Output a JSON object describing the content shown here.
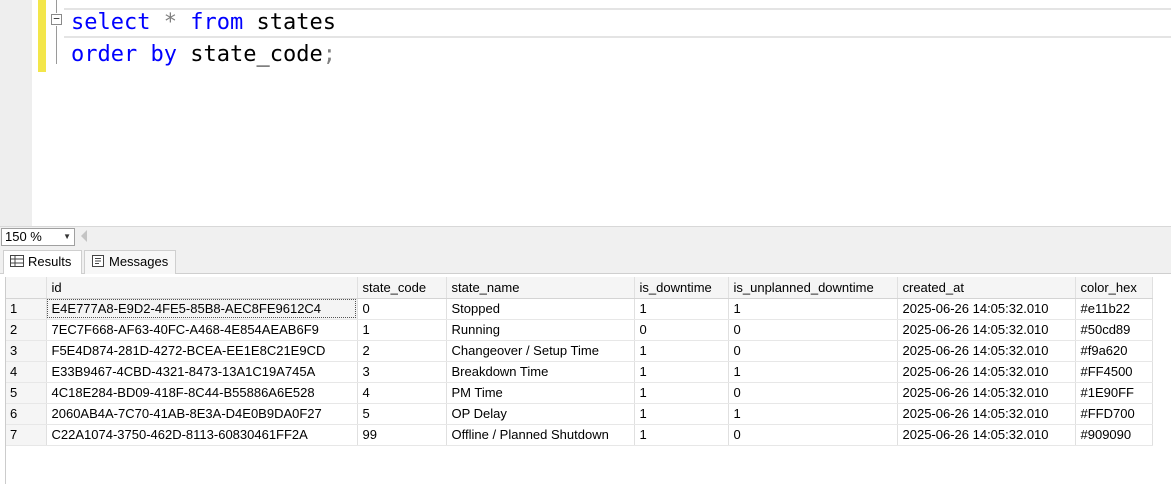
{
  "editor": {
    "line1": {
      "kw1": "select",
      "op": "*",
      "kw2": "from",
      "rest": "states"
    },
    "line2": {
      "kw1": "order",
      "kw2": "by",
      "rest": "state_code",
      "end": ";"
    },
    "collapse_symbol": "−"
  },
  "zoom": {
    "value": "150 %"
  },
  "tabs": {
    "results": "Results",
    "messages": "Messages"
  },
  "grid": {
    "columns": [
      "",
      "id",
      "state_code",
      "state_name",
      "is_downtime",
      "is_unplanned_downtime",
      "created_at",
      "color_hex"
    ],
    "rows": [
      [
        "1",
        "E4E777A8-E9D2-4FE5-85B8-AEC8FE9612C4",
        "0",
        "Stopped",
        "1",
        "1",
        "2025-06-26 14:05:32.010",
        "#e11b22"
      ],
      [
        "2",
        "7EC7F668-AF63-40FC-A468-4E854AEAB6F9",
        "1",
        "Running",
        "0",
        "0",
        "2025-06-26 14:05:32.010",
        "#50cd89"
      ],
      [
        "3",
        "F5E4D874-281D-4272-BCEA-EE1E8C21E9CD",
        "2",
        "Changeover / Setup Time",
        "1",
        "0",
        "2025-06-26 14:05:32.010",
        "#f9a620"
      ],
      [
        "4",
        "E33B9467-4CBD-4321-8473-13A1C19A745A",
        "3",
        "Breakdown Time",
        "1",
        "1",
        "2025-06-26 14:05:32.010",
        "#FF4500"
      ],
      [
        "5",
        "4C18E284-BD09-418F-8C44-B55886A6E528",
        "4",
        "PM Time",
        "1",
        "0",
        "2025-06-26 14:05:32.010",
        "#1E90FF"
      ],
      [
        "6",
        "2060AB4A-7C70-41AB-8E3A-D4E0B9DA0F27",
        "5",
        "OP Delay",
        "1",
        "1",
        "2025-06-26 14:05:32.010",
        "#FFD700"
      ],
      [
        "7",
        "C22A1074-3750-462D-8113-60830461FF2A",
        "99",
        "Offline / Planned Shutdown",
        "1",
        "0",
        "2025-06-26 14:05:32.010",
        "#909090"
      ]
    ]
  },
  "colors": {
    "keyword": "#0000ff",
    "operator": "#808080",
    "change_marker": "#f3e64a"
  }
}
